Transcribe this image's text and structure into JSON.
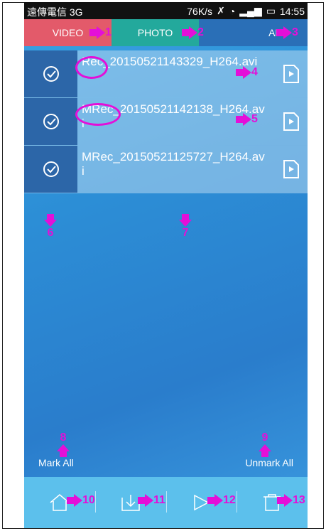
{
  "status": {
    "carrier": "遠傳電信 3G",
    "speed": "76K/s",
    "time": "14:55"
  },
  "tabs": [
    {
      "label": "VIDEO",
      "num": "1"
    },
    {
      "label": "PHOTO",
      "num": "2"
    },
    {
      "label": "ALL",
      "num": "3"
    }
  ],
  "files": [
    {
      "name": "Rec_20150521143329_H264.avi",
      "num": "4"
    },
    {
      "name": "MRec_20150521142138_H264.avi",
      "num": "5"
    },
    {
      "name": "MRec_20150521125727_H264.avi",
      "num": ""
    }
  ],
  "annotations": {
    "check_col": "6",
    "file_area": "7",
    "mark_all": "8",
    "unmark_all": "9"
  },
  "actions": {
    "mark_all": "Mark All",
    "unmark_all": "Unmark All"
  },
  "toolbar": [
    {
      "icon": "home-icon",
      "num": "10"
    },
    {
      "icon": "download-icon",
      "num": "11"
    },
    {
      "icon": "play-icon",
      "num": "12"
    },
    {
      "icon": "trash-icon",
      "num": "13"
    }
  ],
  "colors": {
    "annotation": "#e40fd8",
    "video_tab": "#e35a6a",
    "photo_tab": "#23a99c",
    "all_tab": "#2a6fb7",
    "bottom_bar": "#5cc0ec"
  }
}
